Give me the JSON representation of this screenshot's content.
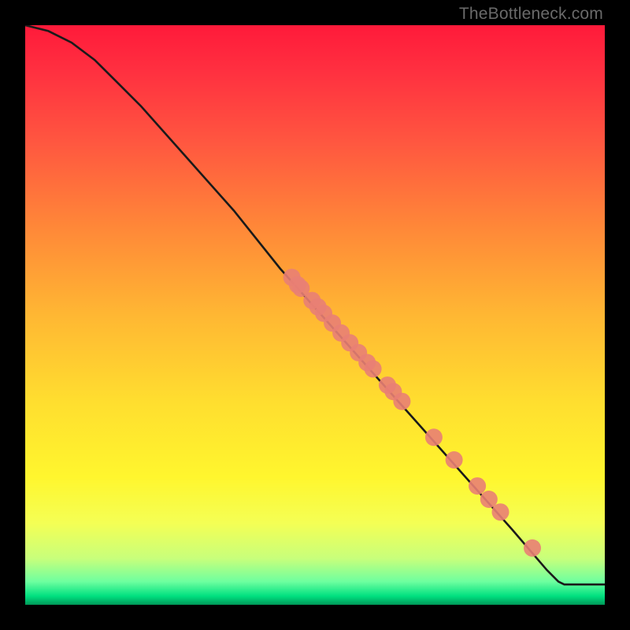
{
  "watermark": "TheBottleneck.com",
  "colors": {
    "frame": "#000000",
    "curve": "#1a1a1a",
    "dot": "#e98074"
  },
  "chart_data": {
    "type": "line",
    "title": "",
    "xlabel": "",
    "ylabel": "",
    "xlim": [
      0,
      100
    ],
    "ylim": [
      0,
      100
    ],
    "curve": [
      {
        "x": 0,
        "y": 100
      },
      {
        "x": 4,
        "y": 99
      },
      {
        "x": 8,
        "y": 97
      },
      {
        "x": 12,
        "y": 94
      },
      {
        "x": 16,
        "y": 90
      },
      {
        "x": 20,
        "y": 86
      },
      {
        "x": 28,
        "y": 77
      },
      {
        "x": 36,
        "y": 68
      },
      {
        "x": 44,
        "y": 58
      },
      {
        "x": 52,
        "y": 49
      },
      {
        "x": 60,
        "y": 40
      },
      {
        "x": 68,
        "y": 31
      },
      {
        "x": 76,
        "y": 22
      },
      {
        "x": 84,
        "y": 13
      },
      {
        "x": 90,
        "y": 6
      },
      {
        "x": 92,
        "y": 4
      },
      {
        "x": 93,
        "y": 3.5
      },
      {
        "x": 100,
        "y": 3.5
      }
    ],
    "points": [
      {
        "x": 46.0,
        "y": 56.5
      },
      {
        "x": 47.0,
        "y": 55.2
      },
      {
        "x": 47.6,
        "y": 54.6
      },
      {
        "x": 49.5,
        "y": 52.5
      },
      {
        "x": 50.5,
        "y": 51.4
      },
      {
        "x": 51.5,
        "y": 50.3
      },
      {
        "x": 53.0,
        "y": 48.6
      },
      {
        "x": 54.5,
        "y": 46.9
      },
      {
        "x": 56.0,
        "y": 45.2
      },
      {
        "x": 57.5,
        "y": 43.5
      },
      {
        "x": 59.0,
        "y": 41.8
      },
      {
        "x": 60.0,
        "y": 40.7
      },
      {
        "x": 62.5,
        "y": 37.9
      },
      {
        "x": 63.5,
        "y": 36.8
      },
      {
        "x": 65.0,
        "y": 35.1
      },
      {
        "x": 70.5,
        "y": 28.9
      },
      {
        "x": 74.0,
        "y": 25.0
      },
      {
        "x": 78.0,
        "y": 20.5
      },
      {
        "x": 80.0,
        "y": 18.2
      },
      {
        "x": 82.0,
        "y": 16.0
      },
      {
        "x": 87.5,
        "y": 9.8
      }
    ],
    "point_radius": 11
  }
}
